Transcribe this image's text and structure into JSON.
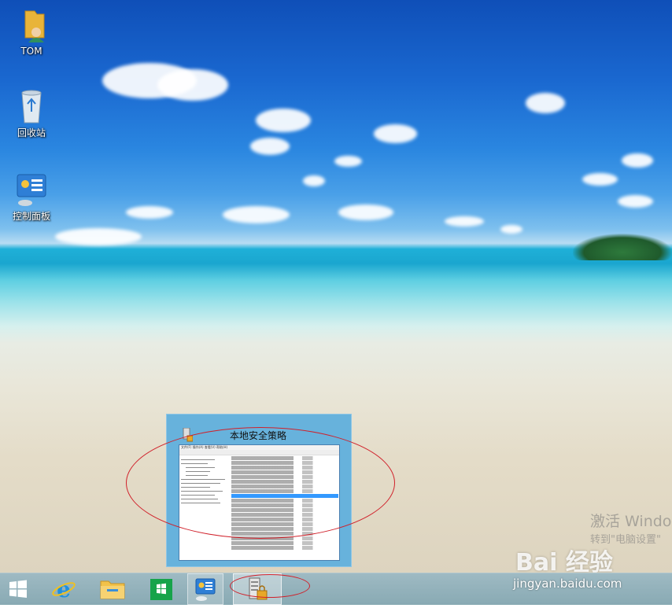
{
  "desktop_icons": [
    {
      "label": "TOM",
      "icon": "user-folder-icon"
    },
    {
      "label": "回收站",
      "icon": "recycle-bin-icon"
    },
    {
      "label": "控制面板",
      "icon": "control-panel-icon"
    }
  ],
  "preview": {
    "title": "本地安全策略",
    "menu": "文件(F)  操作(A)  查看(V)  帮助(H)",
    "icon": "security-policy-icon"
  },
  "taskbar": {
    "items": [
      {
        "name": "start-button",
        "icon": "windows-logo-icon"
      },
      {
        "name": "internet-explorer",
        "icon": "ie-icon"
      },
      {
        "name": "file-explorer",
        "icon": "folder-icon"
      },
      {
        "name": "store",
        "icon": "store-icon"
      },
      {
        "name": "control-panel",
        "icon": "control-panel-icon"
      },
      {
        "name": "local-security-policy",
        "icon": "security-policy-icon"
      }
    ]
  },
  "watermark": {
    "activate_title": "激活 Windo",
    "activate_sub": "转到\"电脑设置\"",
    "brand": "Bai 经验",
    "url": "jingyan.baidu.com"
  },
  "colors": {
    "annotation_red": "#d0202a",
    "taskbar": "#8fb2bb",
    "preview_bg": "#67b2dc"
  }
}
